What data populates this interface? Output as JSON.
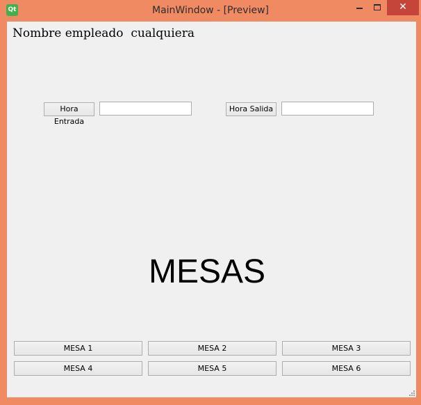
{
  "window": {
    "title": "MainWindow - [Preview]",
    "app_icon_text": "Qt",
    "close_glyph": "✕",
    "accent_color": "#ef8a63",
    "close_color": "#c6453a"
  },
  "employee": {
    "label": "Nombre empleado  cualquiera"
  },
  "time_fields": {
    "entrada_button": "Hora Entrada",
    "entrada_value": "",
    "salida_button": "Hora Salida",
    "salida_value": ""
  },
  "section": {
    "title": "MESAS"
  },
  "tables": {
    "buttons": [
      "MESA 1",
      "MESA 2",
      "MESA 3",
      "MESA 4",
      "MESA 5",
      "MESA 6"
    ]
  },
  "icons": {
    "app": "qt-logo-icon",
    "minimize": "minimize-icon",
    "maximize": "maximize-icon",
    "close": "close-icon",
    "grip": "resize-grip-icon"
  }
}
